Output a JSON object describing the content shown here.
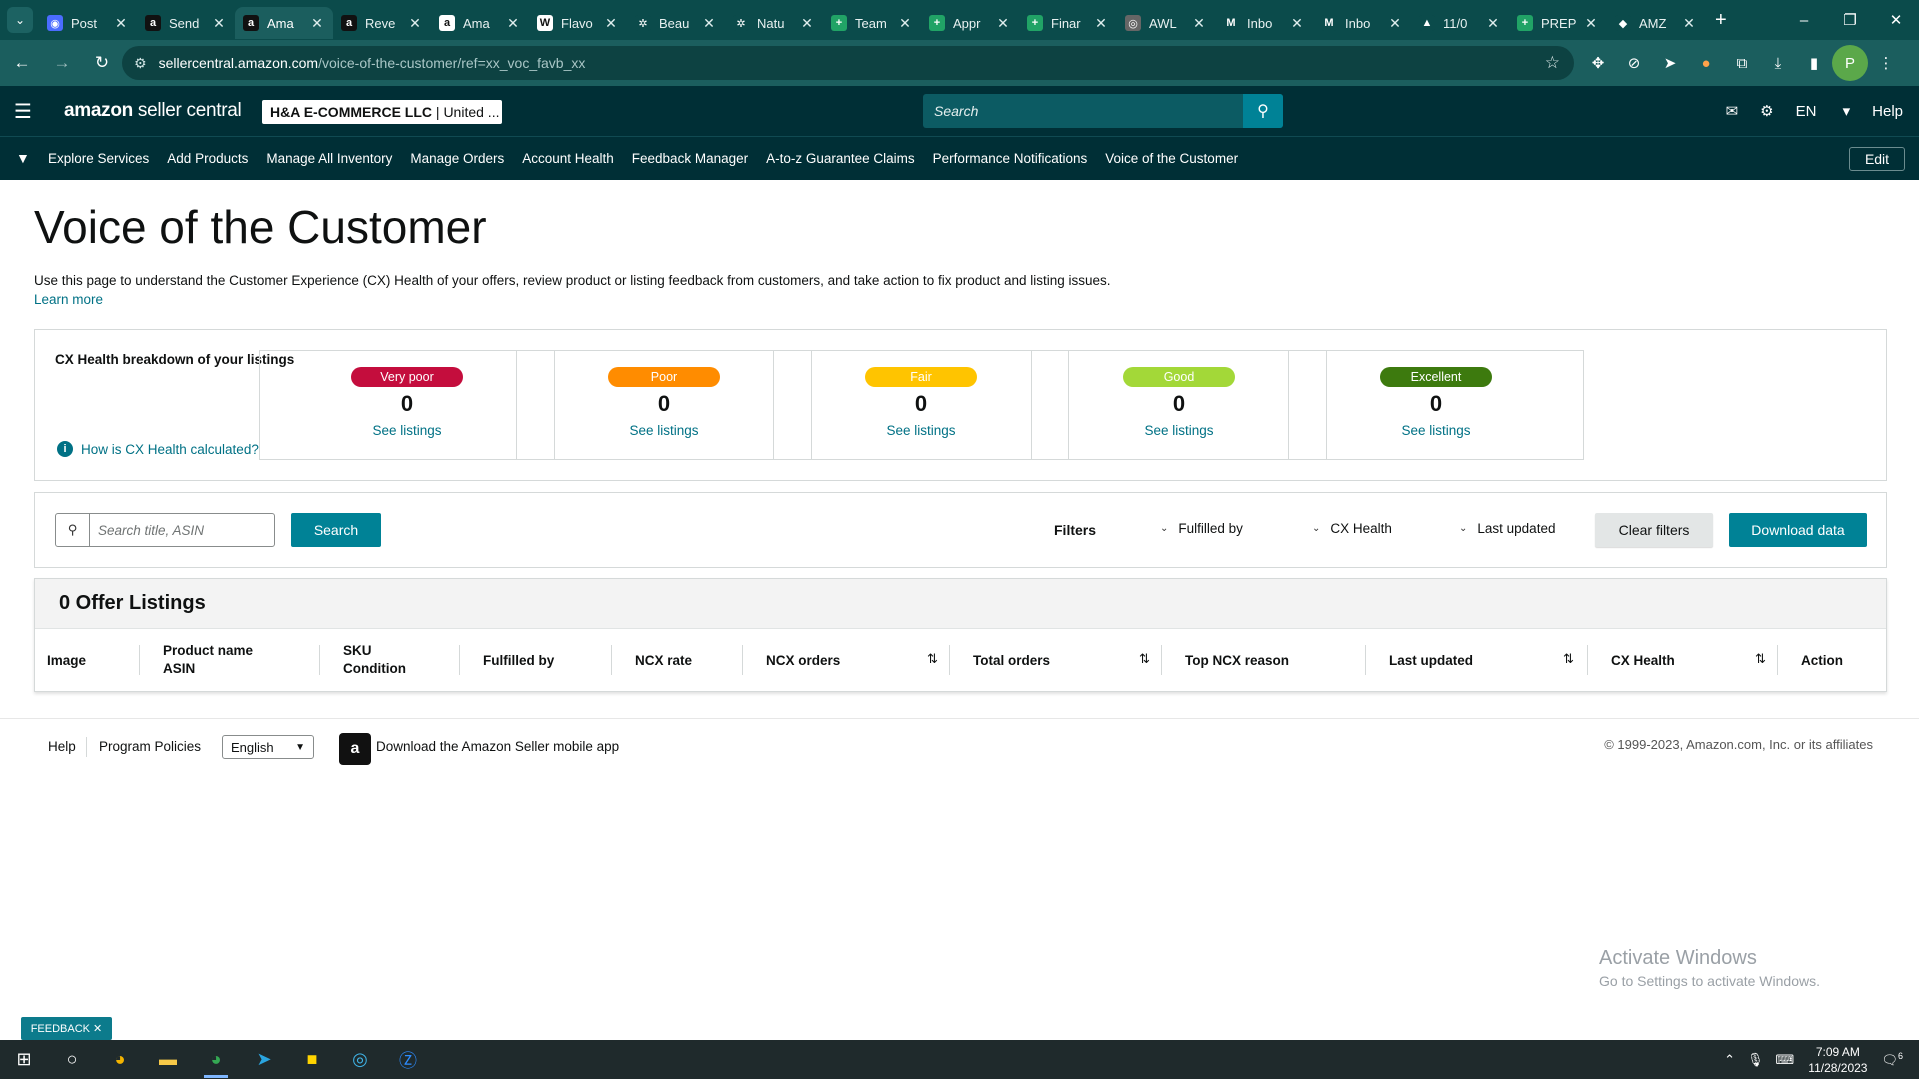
{
  "browser": {
    "tabs": [
      {
        "title": "Post",
        "color": "#4b6cff",
        "glyph": "◉"
      },
      {
        "title": "Send",
        "color": "#111111",
        "glyph": "a"
      },
      {
        "title": "Ama",
        "color": "#111111",
        "glyph": "a",
        "active": true
      },
      {
        "title": "Reve",
        "color": "#111111",
        "glyph": "a"
      },
      {
        "title": "Ama",
        "color": "#ffffff",
        "glyph": "a"
      },
      {
        "title": "Flavo",
        "color": "#ffffff",
        "glyph": "W"
      },
      {
        "title": "Beau",
        "color": "#0b4b4b",
        "glyph": "✲"
      },
      {
        "title": "Natu",
        "color": "#0b4b4b",
        "glyph": "✲"
      },
      {
        "title": "Team",
        "color": "#21a366",
        "glyph": "+"
      },
      {
        "title": "Appr",
        "color": "#21a366",
        "glyph": "+"
      },
      {
        "title": "Finar",
        "color": "#21a366",
        "glyph": "+"
      },
      {
        "title": "AWL",
        "color": "#666666",
        "glyph": "◎"
      },
      {
        "title": "Inbo",
        "color": "#0b4b4b",
        "glyph": "M"
      },
      {
        "title": "Inbo",
        "color": "#0b4b4b",
        "glyph": "M"
      },
      {
        "title": "11/0",
        "color": "#0b4b4b",
        "glyph": "▲"
      },
      {
        "title": "PREP",
        "color": "#21a366",
        "glyph": "+"
      },
      {
        "title": "AMZ",
        "color": "#0b4b4b",
        "glyph": "◆"
      }
    ],
    "url_host": "sellercentral.amazon.com",
    "url_path": "/voice-of-the-customer/ref=xx_voc_favb_xx"
  },
  "header": {
    "logo_main": "amazon",
    "logo_sub": " seller central",
    "account_name": "H&A E-COMMERCE LLC",
    "account_region": " | United ...",
    "search_placeholder": "Search",
    "lang": "EN",
    "help": "Help"
  },
  "nav": {
    "items": [
      "Explore Services",
      "Add Products",
      "Manage All Inventory",
      "Manage Orders",
      "Account Health",
      "Feedback Manager",
      "A-to-z Guarantee Claims",
      "Performance Notifications",
      "Voice of the Customer"
    ],
    "edit": "Edit"
  },
  "page": {
    "title": "Voice of the Customer",
    "description": "Use this page to understand the Customer Experience (CX) Health of your offers, review product or listing feedback from customers, and take action to fix product and listing issues.",
    "learn_more": "Learn more"
  },
  "cx": {
    "title": "CX Health breakdown of your listings",
    "how_link": "How is CX Health calculated?",
    "cards": [
      {
        "label": "Very poor",
        "count": "0",
        "link": "See listings",
        "color": "#c40d3d",
        "text": "#ffffff"
      },
      {
        "label": "Poor",
        "count": "0",
        "link": "See listings",
        "color": "#ff8c00",
        "text": "#ffffff"
      },
      {
        "label": "Fair",
        "count": "0",
        "link": "See listings",
        "color": "#ffc400",
        "text": "#ffffff"
      },
      {
        "label": "Good",
        "count": "0",
        "link": "See listings",
        "color": "#a3d838",
        "text": "#ffffff"
      },
      {
        "label": "Excellent",
        "count": "0",
        "link": "See listings",
        "color": "#3d7a0e",
        "text": "#ffffff"
      }
    ]
  },
  "search": {
    "placeholder": "Search title, ASIN",
    "button": "Search",
    "filters_label": "Filters",
    "filter_fulfilled": "Fulfilled by",
    "filter_cx": "CX Health",
    "filter_updated": "Last updated",
    "clear": "Clear filters",
    "download": "Download data"
  },
  "listings": {
    "heading": "0 Offer Listings",
    "columns": {
      "image": "Image",
      "product": "Product name",
      "asin": "ASIN",
      "sku": "SKU",
      "condition": "Condition",
      "fulfilled": "Fulfilled by",
      "ncx_rate": "NCX rate",
      "ncx_orders": "NCX orders",
      "total_orders": "Total orders",
      "top_reason": "Top NCX reason",
      "last_updated": "Last updated",
      "cx_health": "CX Health",
      "action": "Action"
    }
  },
  "footer": {
    "help": "Help",
    "policies": "Program Policies",
    "language": "English",
    "app": "Download the Amazon Seller mobile app",
    "copyright": "© 1999-2023, Amazon.com, Inc. or its affiliates"
  },
  "windows": {
    "activate_title": "Activate Windows",
    "activate_sub": "Go to Settings to activate Windows.",
    "time": "7:09 AM",
    "date": "11/28/2023",
    "notif": "6"
  },
  "feedback": "FEEDBACK"
}
